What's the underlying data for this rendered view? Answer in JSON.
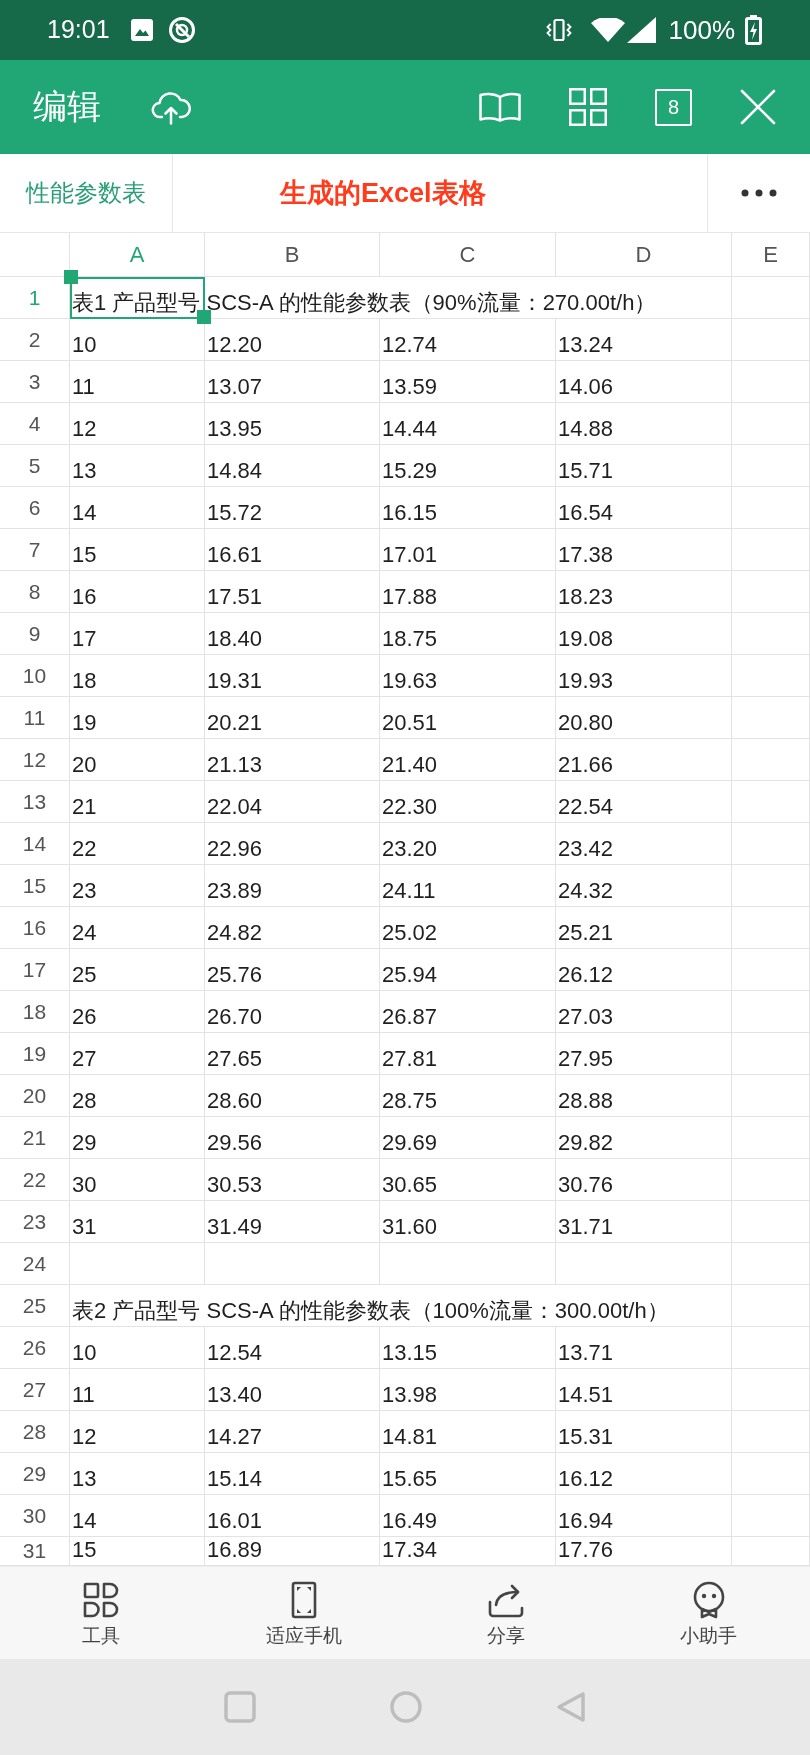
{
  "status_bar": {
    "time": "19:01",
    "battery": "100%"
  },
  "app_bar": {
    "title": "编辑",
    "tab_count": "8"
  },
  "sheet_tabs": [
    {
      "label": "性能参数表",
      "selected": true
    }
  ],
  "annotation": "生成的Excel表格",
  "columns": [
    {
      "label": "A",
      "selected": true
    },
    {
      "label": "B",
      "selected": false
    },
    {
      "label": "C",
      "selected": false
    },
    {
      "label": "D",
      "selected": false
    },
    {
      "label": "E",
      "selected": false
    }
  ],
  "rows": [
    {
      "number": "1",
      "selected": true,
      "kind": "title",
      "text": "表1 产品型号 SCS-A 的性能参数表（90%流量：270.00t/h）"
    },
    {
      "number": "2",
      "selected": false,
      "kind": "data",
      "cells": [
        "10",
        "12.20",
        "12.74",
        "13.24"
      ]
    },
    {
      "number": "3",
      "selected": false,
      "kind": "data",
      "cells": [
        "11",
        "13.07",
        "13.59",
        "14.06"
      ]
    },
    {
      "number": "4",
      "selected": false,
      "kind": "data",
      "cells": [
        "12",
        "13.95",
        "14.44",
        "14.88"
      ]
    },
    {
      "number": "5",
      "selected": false,
      "kind": "data",
      "cells": [
        "13",
        "14.84",
        "15.29",
        "15.71"
      ]
    },
    {
      "number": "6",
      "selected": false,
      "kind": "data",
      "cells": [
        "14",
        "15.72",
        "16.15",
        "16.54"
      ]
    },
    {
      "number": "7",
      "selected": false,
      "kind": "data",
      "cells": [
        "15",
        "16.61",
        "17.01",
        "17.38"
      ]
    },
    {
      "number": "8",
      "selected": false,
      "kind": "data",
      "cells": [
        "16",
        "17.51",
        "17.88",
        "18.23"
      ]
    },
    {
      "number": "9",
      "selected": false,
      "kind": "data",
      "cells": [
        "17",
        "18.40",
        "18.75",
        "19.08"
      ]
    },
    {
      "number": "10",
      "selected": false,
      "kind": "data",
      "cells": [
        "18",
        "19.31",
        "19.63",
        "19.93"
      ]
    },
    {
      "number": "11",
      "selected": false,
      "kind": "data",
      "cells": [
        "19",
        "20.21",
        "20.51",
        "20.80"
      ]
    },
    {
      "number": "12",
      "selected": false,
      "kind": "data",
      "cells": [
        "20",
        "21.13",
        "21.40",
        "21.66"
      ]
    },
    {
      "number": "13",
      "selected": false,
      "kind": "data",
      "cells": [
        "21",
        "22.04",
        "22.30",
        "22.54"
      ]
    },
    {
      "number": "14",
      "selected": false,
      "kind": "data",
      "cells": [
        "22",
        "22.96",
        "23.20",
        "23.42"
      ]
    },
    {
      "number": "15",
      "selected": false,
      "kind": "data",
      "cells": [
        "23",
        "23.89",
        "24.11",
        "24.32"
      ]
    },
    {
      "number": "16",
      "selected": false,
      "kind": "data",
      "cells": [
        "24",
        "24.82",
        "25.02",
        "25.21"
      ]
    },
    {
      "number": "17",
      "selected": false,
      "kind": "data",
      "cells": [
        "25",
        "25.76",
        "25.94",
        "26.12"
      ]
    },
    {
      "number": "18",
      "selected": false,
      "kind": "data",
      "cells": [
        "26",
        "26.70",
        "26.87",
        "27.03"
      ]
    },
    {
      "number": "19",
      "selected": false,
      "kind": "data",
      "cells": [
        "27",
        "27.65",
        "27.81",
        "27.95"
      ]
    },
    {
      "number": "20",
      "selected": false,
      "kind": "data",
      "cells": [
        "28",
        "28.60",
        "28.75",
        "28.88"
      ]
    },
    {
      "number": "21",
      "selected": false,
      "kind": "data",
      "cells": [
        "29",
        "29.56",
        "29.69",
        "29.82"
      ]
    },
    {
      "number": "22",
      "selected": false,
      "kind": "data",
      "cells": [
        "30",
        "30.53",
        "30.65",
        "30.76"
      ]
    },
    {
      "number": "23",
      "selected": false,
      "kind": "data",
      "cells": [
        "31",
        "31.49",
        "31.60",
        "31.71"
      ]
    },
    {
      "number": "24",
      "selected": false,
      "kind": "empty"
    },
    {
      "number": "25",
      "selected": false,
      "kind": "title",
      "text": "表2 产品型号 SCS-A 的性能参数表（100%流量：300.00t/h）"
    },
    {
      "number": "26",
      "selected": false,
      "kind": "data",
      "cells": [
        "10",
        "12.54",
        "13.15",
        "13.71"
      ]
    },
    {
      "number": "27",
      "selected": false,
      "kind": "data",
      "cells": [
        "11",
        "13.40",
        "13.98",
        "14.51"
      ]
    },
    {
      "number": "28",
      "selected": false,
      "kind": "data",
      "cells": [
        "12",
        "14.27",
        "14.81",
        "15.31"
      ]
    },
    {
      "number": "29",
      "selected": false,
      "kind": "data",
      "cells": [
        "13",
        "15.14",
        "15.65",
        "16.12"
      ]
    },
    {
      "number": "30",
      "selected": false,
      "kind": "data",
      "cells": [
        "14",
        "16.01",
        "16.49",
        "16.94"
      ]
    },
    {
      "number": "31",
      "selected": false,
      "kind": "data",
      "cells": [
        "15",
        "16.89",
        "17.34",
        "17.76"
      ]
    }
  ],
  "toolbar": [
    {
      "kind": "tools",
      "label": "工具"
    },
    {
      "kind": "fit",
      "label": "适应手机"
    },
    {
      "kind": "share",
      "label": "分享"
    },
    {
      "kind": "assistant",
      "label": "小助手"
    }
  ]
}
